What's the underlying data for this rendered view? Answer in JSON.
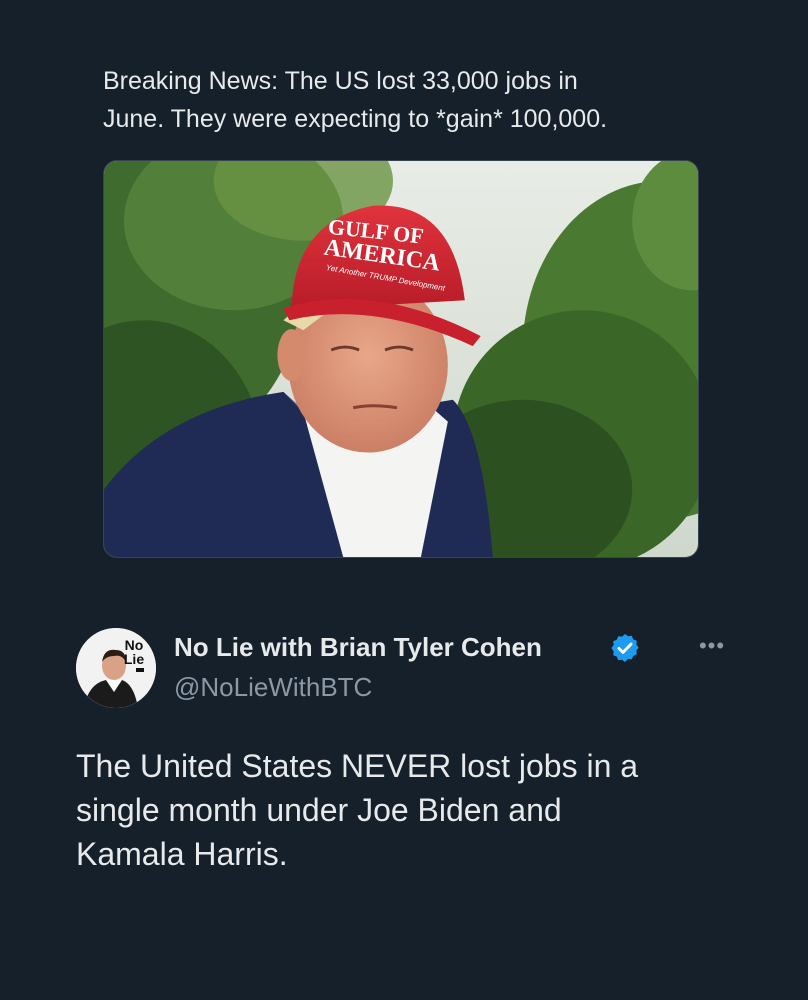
{
  "quoted_post": {
    "text": "Breaking News: The US lost 33,000 jobs in\nJune. They were expecting to *gain* 100,000.",
    "photo": {
      "cap_text_line1": "GULF OF",
      "cap_text_line2": "AMERICA",
      "cap_text_line3": "Yet Another TRUMP Development"
    }
  },
  "tweet": {
    "author": {
      "display_name": "No Lie with Brian Tyler Cohen",
      "handle": "@NoLieWithBTC",
      "verified": true,
      "avatar_label_top": "No",
      "avatar_label_bottom": "Lie"
    },
    "more_icon": "more-horizontal-icon",
    "text": "The United States NEVER lost jobs in a\nsingle month under Joe Biden and\nKamala Harris."
  },
  "colors": {
    "background": "#15202b",
    "primary_text": "#e7e9ea",
    "secondary_text": "#8b98a5",
    "verified_blue": "#1d9bf0"
  }
}
